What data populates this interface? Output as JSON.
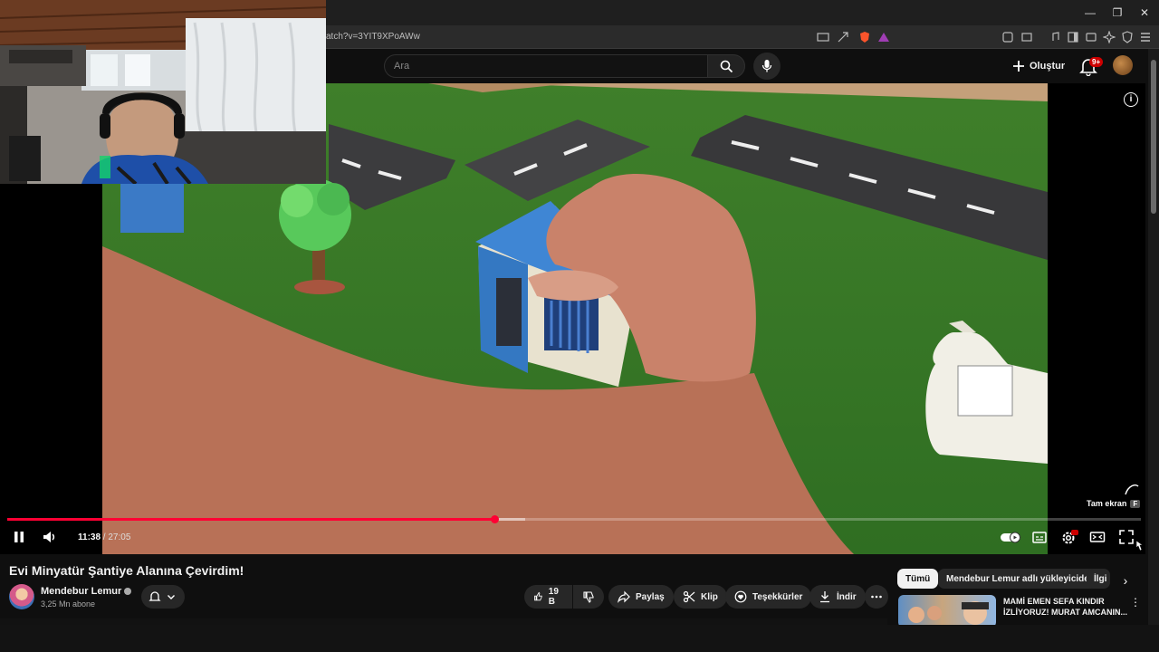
{
  "browser": {
    "url": "atch?v=3YIT9XPoAWw"
  },
  "header": {
    "search_placeholder": "Ara",
    "create_label": "Oluştur",
    "notification_badge": "9+"
  },
  "player": {
    "current_time": "11:38",
    "duration": "27:05",
    "time_separator": " / ",
    "progress": 0.4296,
    "buffered": 0.457,
    "tooltip_label": "Tam ekran",
    "tooltip_key": "F",
    "settings_badge": "HD",
    "info_icon_text": "i",
    "accent_color": "#ff0033"
  },
  "video": {
    "title": "Evi Minyatür Şantiye Alanına Çevirdim!",
    "channel_name": "Mendebur Lemur",
    "subscribers": "3,25 Mn abone",
    "like_count": "19 B",
    "share_label": "Paylaş",
    "clip_label": "Klip",
    "thanks_label": "Teşekkürler",
    "download_label": "İndir"
  },
  "sidebar": {
    "chips": [
      "Tümü",
      "Mendebur Lemur adlı yükleyiciden",
      "İlgi"
    ],
    "recommendation": {
      "title": "MAMİ EMEN SEFA KINDIR İZLİYORUZ! MURAT AMCANIN..."
    }
  },
  "icons": {
    "pause": "pause-icon",
    "volume": "volume-icon",
    "autoplay": "autoplay-toggle-icon",
    "subtitles": "subtitles-icon",
    "settings": "gear-icon",
    "theater": "theater-mode-icon",
    "fullscreen": "fullscreen-icon"
  }
}
